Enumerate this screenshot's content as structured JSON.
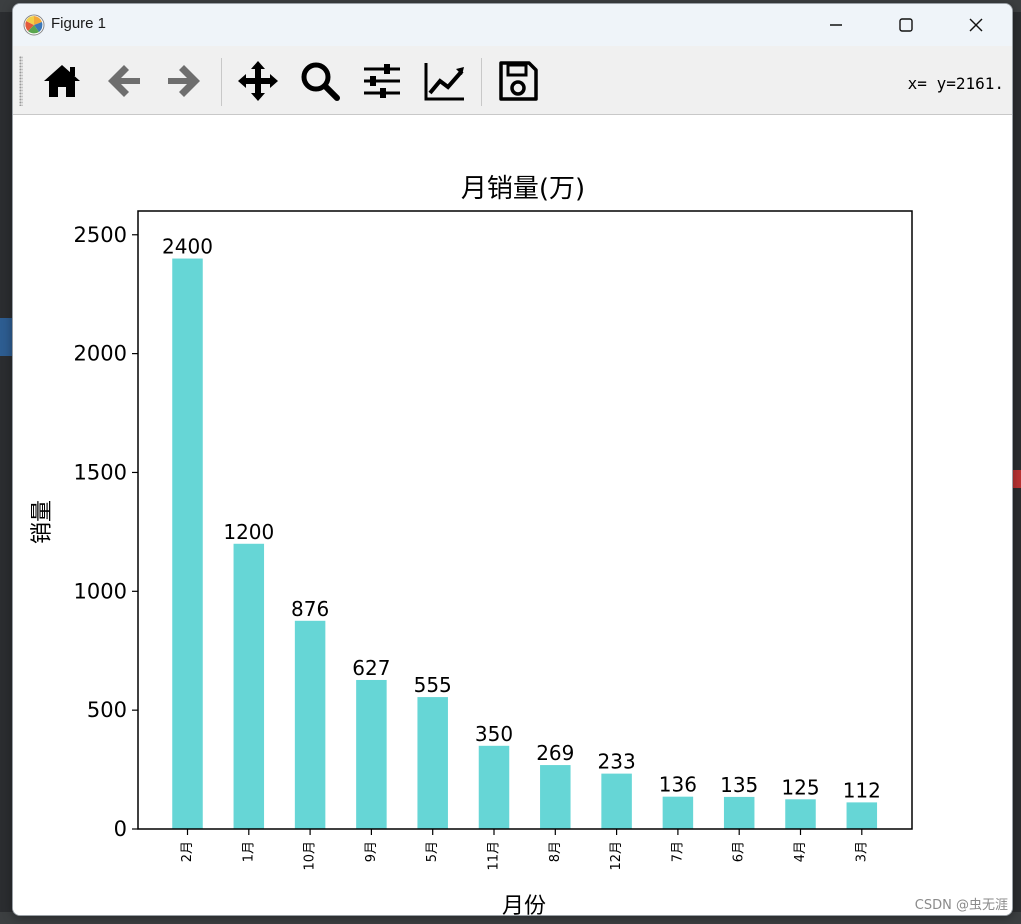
{
  "window": {
    "title": "Figure 1",
    "controls": {
      "minimize": "minimize",
      "maximize": "maximize",
      "close": "close"
    }
  },
  "toolbar": {
    "tools": [
      {
        "name": "home-icon"
      },
      {
        "name": "back-arrow-icon"
      },
      {
        "name": "forward-arrow-icon"
      },
      {
        "name": "pan-move-icon"
      },
      {
        "name": "zoom-magnifier-icon"
      },
      {
        "name": "configure-subplots-icon"
      },
      {
        "name": "edit-axis-line-icon"
      },
      {
        "name": "save-floppy-icon"
      }
    ],
    "coordinates": "x= y=2161."
  },
  "watermark": "CSDN @虫无涯",
  "colors": {
    "bar": "#66d6d6",
    "titlebar": "#eff4f9",
    "toolbar": "#f0f0f0"
  },
  "chart_data": {
    "type": "bar",
    "title": "月销量(万)",
    "xlabel": "月份",
    "ylabel": "销量",
    "categories": [
      "2月",
      "1月",
      "10月",
      "9月",
      "5月",
      "11月",
      "8月",
      "12月",
      "7月",
      "6月",
      "4月",
      "3月"
    ],
    "values": [
      2400,
      1200,
      876,
      627,
      555,
      350,
      269,
      233,
      136,
      135,
      125,
      112
    ],
    "ylim": [
      0,
      2600
    ],
    "yticks": [
      0,
      500,
      1000,
      1500,
      2000,
      2500
    ],
    "data_labels": true,
    "grid": false,
    "xtick_rotation": 90
  }
}
